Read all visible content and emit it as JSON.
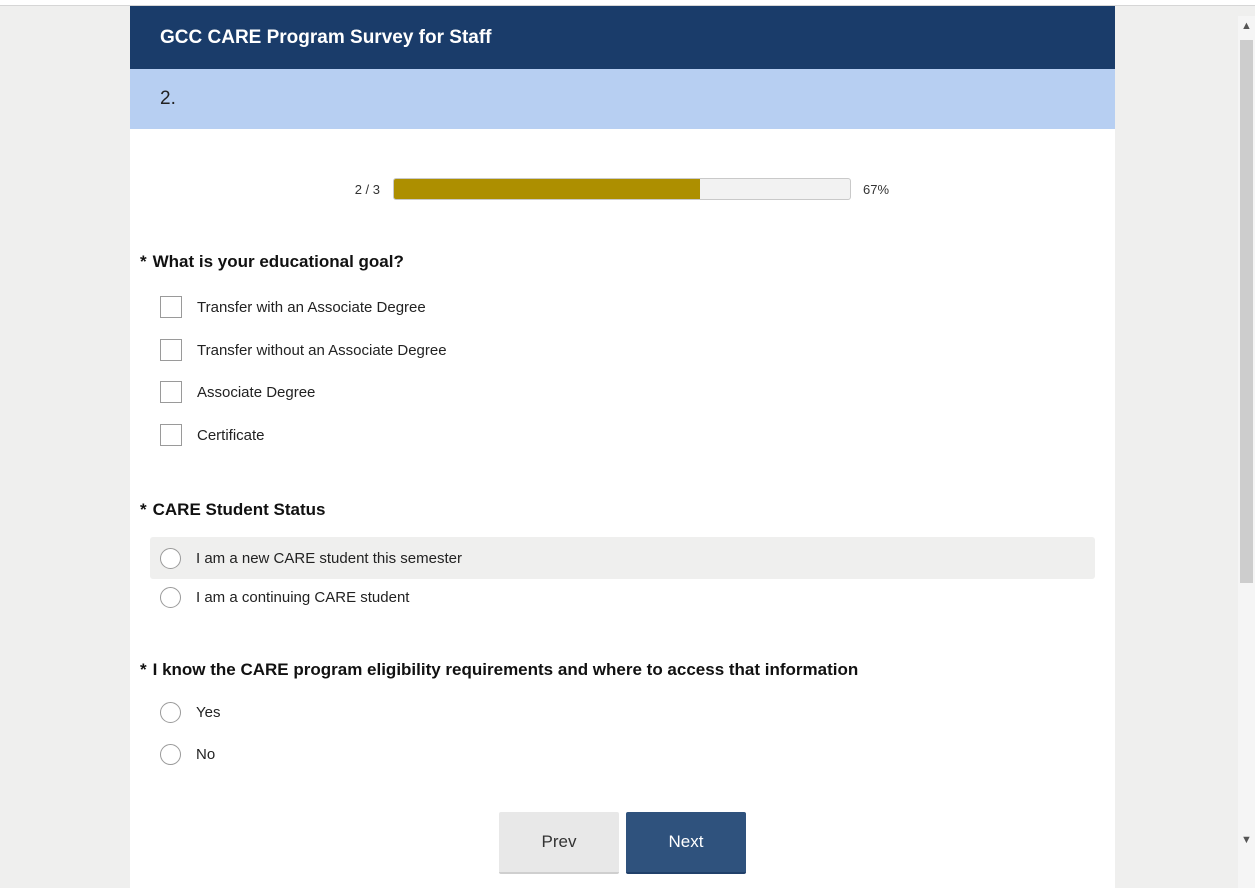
{
  "survey": {
    "title": "GCC CARE Program Survey for Staff",
    "page_number": "2."
  },
  "progress": {
    "count_text": "2 / 3",
    "percent_text": "67%",
    "fraction": 0.67,
    "fill_color": "#ad8f00"
  },
  "questions": [
    {
      "required_mark": "*",
      "title": "What is your educational goal?",
      "type": "checkbox",
      "options": [
        "Transfer with an Associate Degree",
        "Transfer without an Associate Degree",
        "Associate Degree",
        "Certificate"
      ]
    },
    {
      "required_mark": "*",
      "title": "CARE Student Status",
      "type": "radio",
      "options": [
        "I am a new CARE student this semester",
        "I am a continuing CARE student"
      ]
    },
    {
      "required_mark": "*",
      "title": "I know the CARE program eligibility requirements and where to access that information",
      "type": "radio",
      "options": [
        "Yes",
        "No"
      ]
    }
  ],
  "nav": {
    "prev_label": "Prev",
    "next_label": "Next"
  },
  "scrollbar": {
    "up_icon": "▲",
    "down_icon": "▼"
  },
  "colors": {
    "header_bg": "#1a3c6a",
    "page_bar_bg": "#b7cff2",
    "next_button_bg": "#2f527d"
  }
}
